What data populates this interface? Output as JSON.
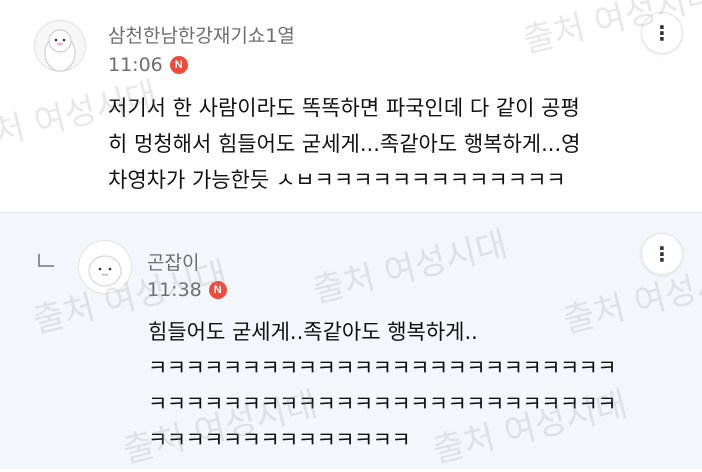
{
  "comments": [
    {
      "author": "삼천한남한강재기쇼1열",
      "time": "11:06",
      "badge": "N",
      "avatar_icon": "penguin-avatar-icon",
      "lines": [
        "저기서 한 사람이라도 똑똑하면 파국인데 다 같이 공평",
        "히 멍청해서 힘들어도 굳세게...족같아도 행복하게...영",
        "차영차가 가능한듯 ㅅㅂㅋㅋㅋㅋㅋㅋㅋㅋㅋㅋㅋㅋㅋ"
      ]
    },
    {
      "author": "곤잡이",
      "time": "11:38",
      "badge": "N",
      "avatar_icon": "white-blob-avatar-icon",
      "lines": [
        "힘들어도 굳세게..족같아도 행복하게..",
        "ㅋㅋㅋㅋㅋㅋㅋㅋㅋㅋㅋㅋㅋㅋㅋㅋㅋㅋㅋㅋㅋㅋㅋㅋㅋ",
        "ㅋㅋㅋㅋㅋㅋㅋㅋㅋㅋㅋㅋㅋㅋㅋㅋㅋㅋㅋㅋㅋㅋㅋㅋㅋ",
        "ㅋㅋㅋㅋㅋㅋㅋㅋㅋㅋㅋㅋㅋㅋ"
      ]
    }
  ],
  "more_icon": "⋮",
  "reply_icon": "reply-arrow-icon",
  "watermarks": [
    "출처 여성시대",
    "출처 여성시대",
    "출처 여성시대",
    "출처 여성시대",
    "출처 여성시대",
    "출처 여성시대",
    "출처 여성시대"
  ],
  "colors": {
    "badge": "#ef4b3c",
    "reply_bg": "#f3f6fb",
    "meta_text": "#6e6e6e"
  }
}
